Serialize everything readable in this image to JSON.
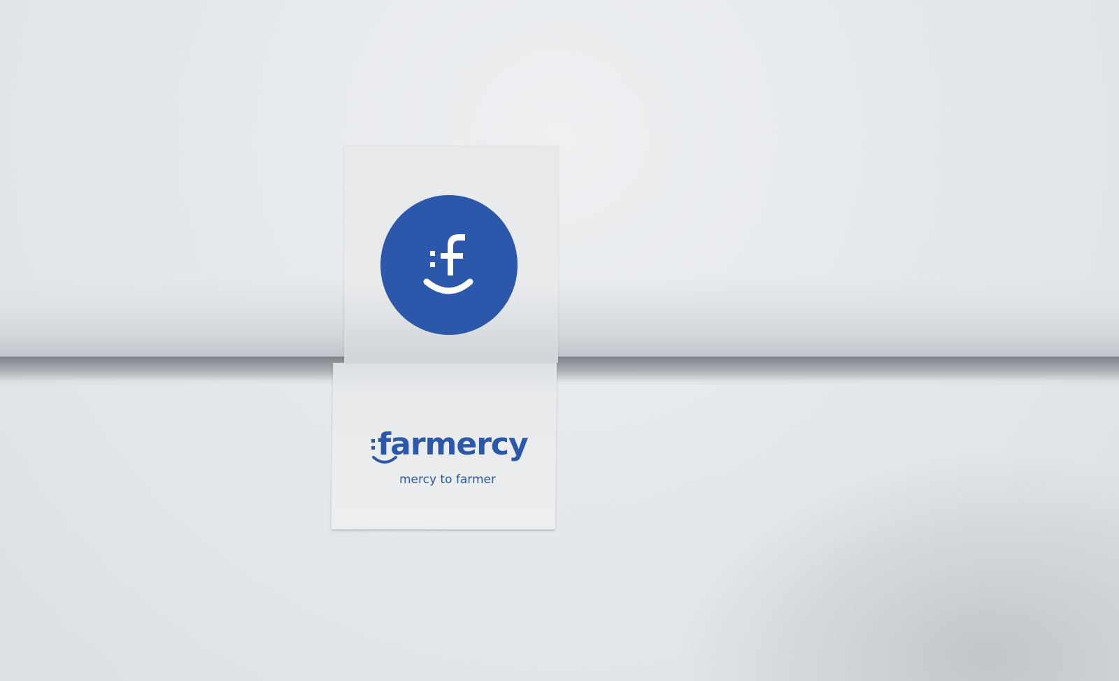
{
  "brand": {
    "name": "farmercy",
    "tagline": "mercy to farmer",
    "logo_letter": "f",
    "accent_color": "#2b58ab"
  },
  "scene": {
    "background_color": "#e6e9ec",
    "card_color": "#e8eaec"
  },
  "icons": {
    "logo_mark": "smiling-f-icon"
  }
}
